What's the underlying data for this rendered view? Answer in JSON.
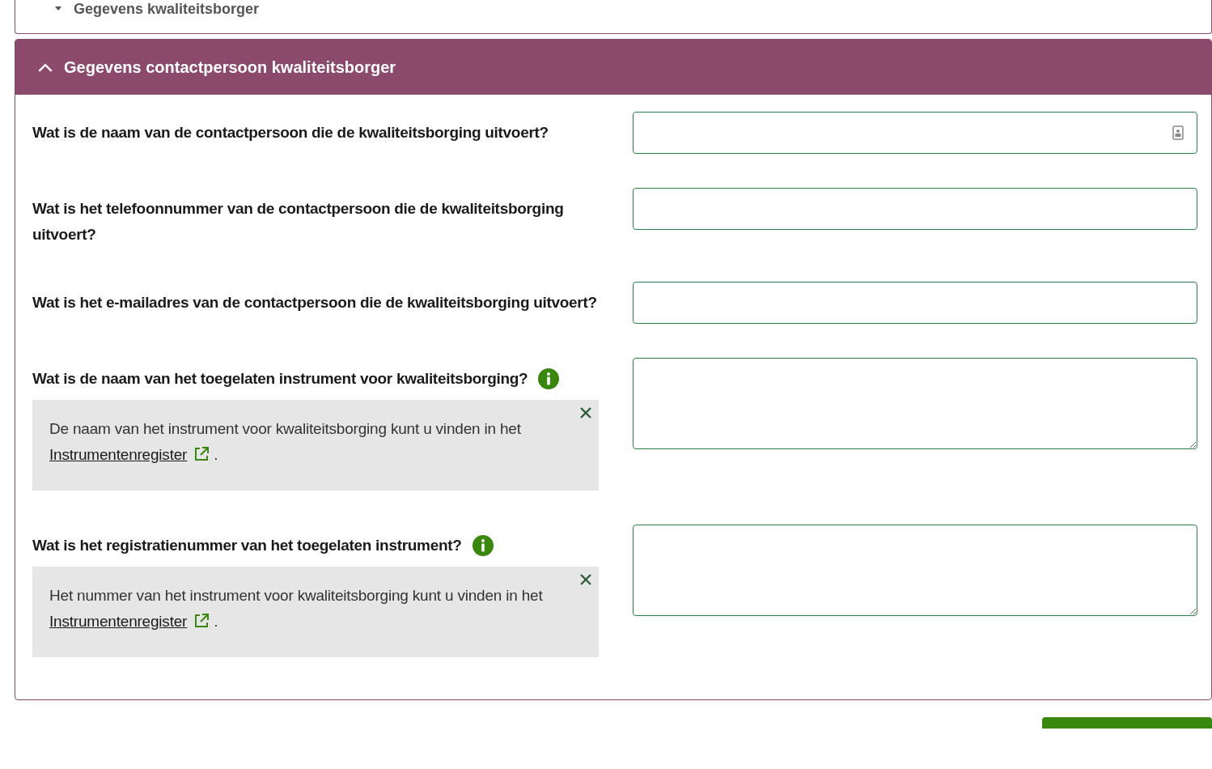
{
  "sections": [
    {
      "title": "Gegevens kwaliteitsborger",
      "expanded": false
    },
    {
      "title": "Gegevens contactpersoon kwaliteitsborger",
      "expanded": true,
      "questions": [
        {
          "label": "Wat is de naam van de contactpersoon die de kwaliteitsborging uitvoert?",
          "kind": "input",
          "autofill_icon": true
        },
        {
          "label": "Wat is het telefoonnummer van de contactpersoon die de kwaliteitsborging uitvoert?",
          "kind": "input"
        },
        {
          "label": "Wat is het e-mailadres van de contactpersoon die de kwaliteitsborging uitvoert?",
          "kind": "input"
        },
        {
          "label": "Wat is de naam van het toegelaten instrument voor kwaliteitsborging?",
          "kind": "textarea",
          "info": {
            "open": true,
            "text": "De naam van het instrument voor kwaliteitsborging kunt u vinden in het",
            "link": "Instrumentenregister",
            "end": "."
          }
        },
        {
          "label": "Wat is het registratienummer van het toegelaten instrument?",
          "kind": "textarea",
          "info": {
            "open": true,
            "text": "Het nummer van het instrument voor kwaliteitsborging kunt u vinden in het",
            "link": "Instrumentenregister",
            "end": "."
          }
        }
      ]
    }
  ],
  "next_button": {
    "visible": true
  }
}
